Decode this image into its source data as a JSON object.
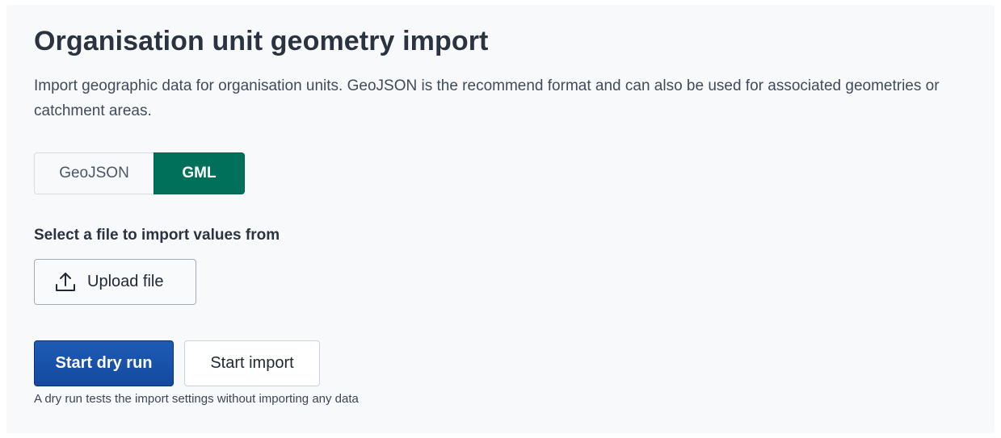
{
  "page": {
    "title": "Organisation unit geometry import",
    "description": "Import geographic data for organisation units. GeoJSON is the recommend format and can also be used for associated geometries or catchment areas."
  },
  "format_toggle": {
    "options": [
      {
        "label": "GeoJSON",
        "selected": false
      },
      {
        "label": "GML",
        "selected": true
      }
    ],
    "selected_color": "#00705a"
  },
  "file_select": {
    "label": "Select a file to import values from",
    "upload_button_label": "Upload file",
    "upload_icon": "upload-icon"
  },
  "actions": {
    "dry_run_label": "Start dry run",
    "import_label": "Start import",
    "help_text": "A dry run tests the import settings without importing any data",
    "primary_color": "#1449a0"
  }
}
